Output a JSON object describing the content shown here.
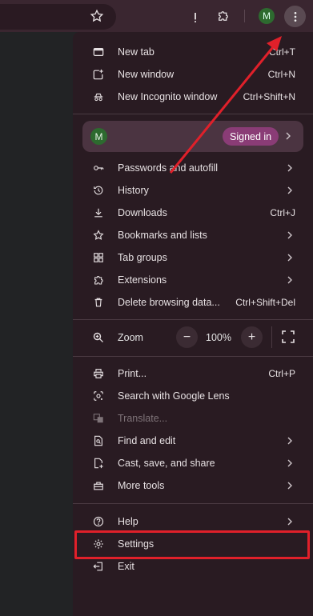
{
  "toolbar": {
    "avatar_initial": "M"
  },
  "menu": {
    "group1": [
      {
        "label": "New tab",
        "shortcut": "Ctrl+T",
        "icon": "new-tab-icon"
      },
      {
        "label": "New window",
        "shortcut": "Ctrl+N",
        "icon": "new-window-icon"
      },
      {
        "label": "New Incognito window",
        "shortcut": "Ctrl+Shift+N",
        "icon": "incognito-icon"
      }
    ],
    "profile": {
      "initial": "M",
      "status": "Signed in"
    },
    "group2": [
      {
        "label": "Passwords and autofill",
        "icon": "key-icon"
      },
      {
        "label": "History",
        "icon": "history-icon"
      },
      {
        "label": "Downloads",
        "shortcut": "Ctrl+J",
        "icon": "download-icon"
      },
      {
        "label": "Bookmarks and lists",
        "icon": "star-icon"
      },
      {
        "label": "Tab groups",
        "icon": "tab-groups-icon"
      },
      {
        "label": "Extensions",
        "icon": "puzzle-icon"
      },
      {
        "label": "Delete browsing data...",
        "shortcut": "Ctrl+Shift+Del",
        "icon": "trash-icon"
      }
    ],
    "zoom": {
      "label": "Zoom",
      "value": "100%",
      "minus": "−",
      "plus": "+"
    },
    "group3": [
      {
        "label": "Print...",
        "shortcut": "Ctrl+P",
        "icon": "print-icon"
      },
      {
        "label": "Search with Google Lens",
        "icon": "lens-icon"
      },
      {
        "label": "Translate...",
        "icon": "translate-icon"
      },
      {
        "label": "Find and edit",
        "icon": "find-icon"
      },
      {
        "label": "Cast, save, and share",
        "icon": "cast-icon"
      },
      {
        "label": "More tools",
        "icon": "toolbox-icon"
      }
    ],
    "group4": [
      {
        "label": "Help",
        "icon": "help-icon"
      },
      {
        "label": "Settings",
        "icon": "gear-icon"
      },
      {
        "label": "Exit",
        "icon": "exit-icon"
      }
    ]
  },
  "colors": {
    "highlight": "#e0202a",
    "badge": "#8a3c76",
    "avatar": "#2d6a2f"
  }
}
